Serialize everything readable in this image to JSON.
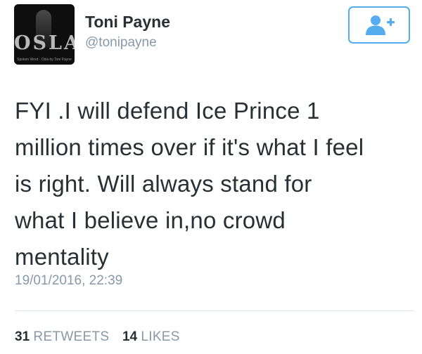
{
  "user": {
    "name": "Toni Payne",
    "handle": "@tonipayne",
    "avatar": {
      "logo_text": "OSLA",
      "caption": "Spoken Word · Osla by Toni Payne"
    }
  },
  "follow_button": {
    "icon": "follow-user-plus-icon",
    "color": "#55acee"
  },
  "tweet": {
    "text": "FYI .I will defend Ice Prince 1\nmillion times over if it's what I feel\nis right. Will always stand for\nwhat I believe in,no crowd\nmentality",
    "timestamp": "19/01/2016, 22:39"
  },
  "stats": {
    "retweets_count": "31",
    "retweets_label": "RETWEETS",
    "likes_count": "14",
    "likes_label": "LIKES"
  },
  "colors": {
    "text": "#292f33",
    "muted": "#8899a6",
    "accent": "#55acee",
    "divider": "#e1e8ed"
  }
}
